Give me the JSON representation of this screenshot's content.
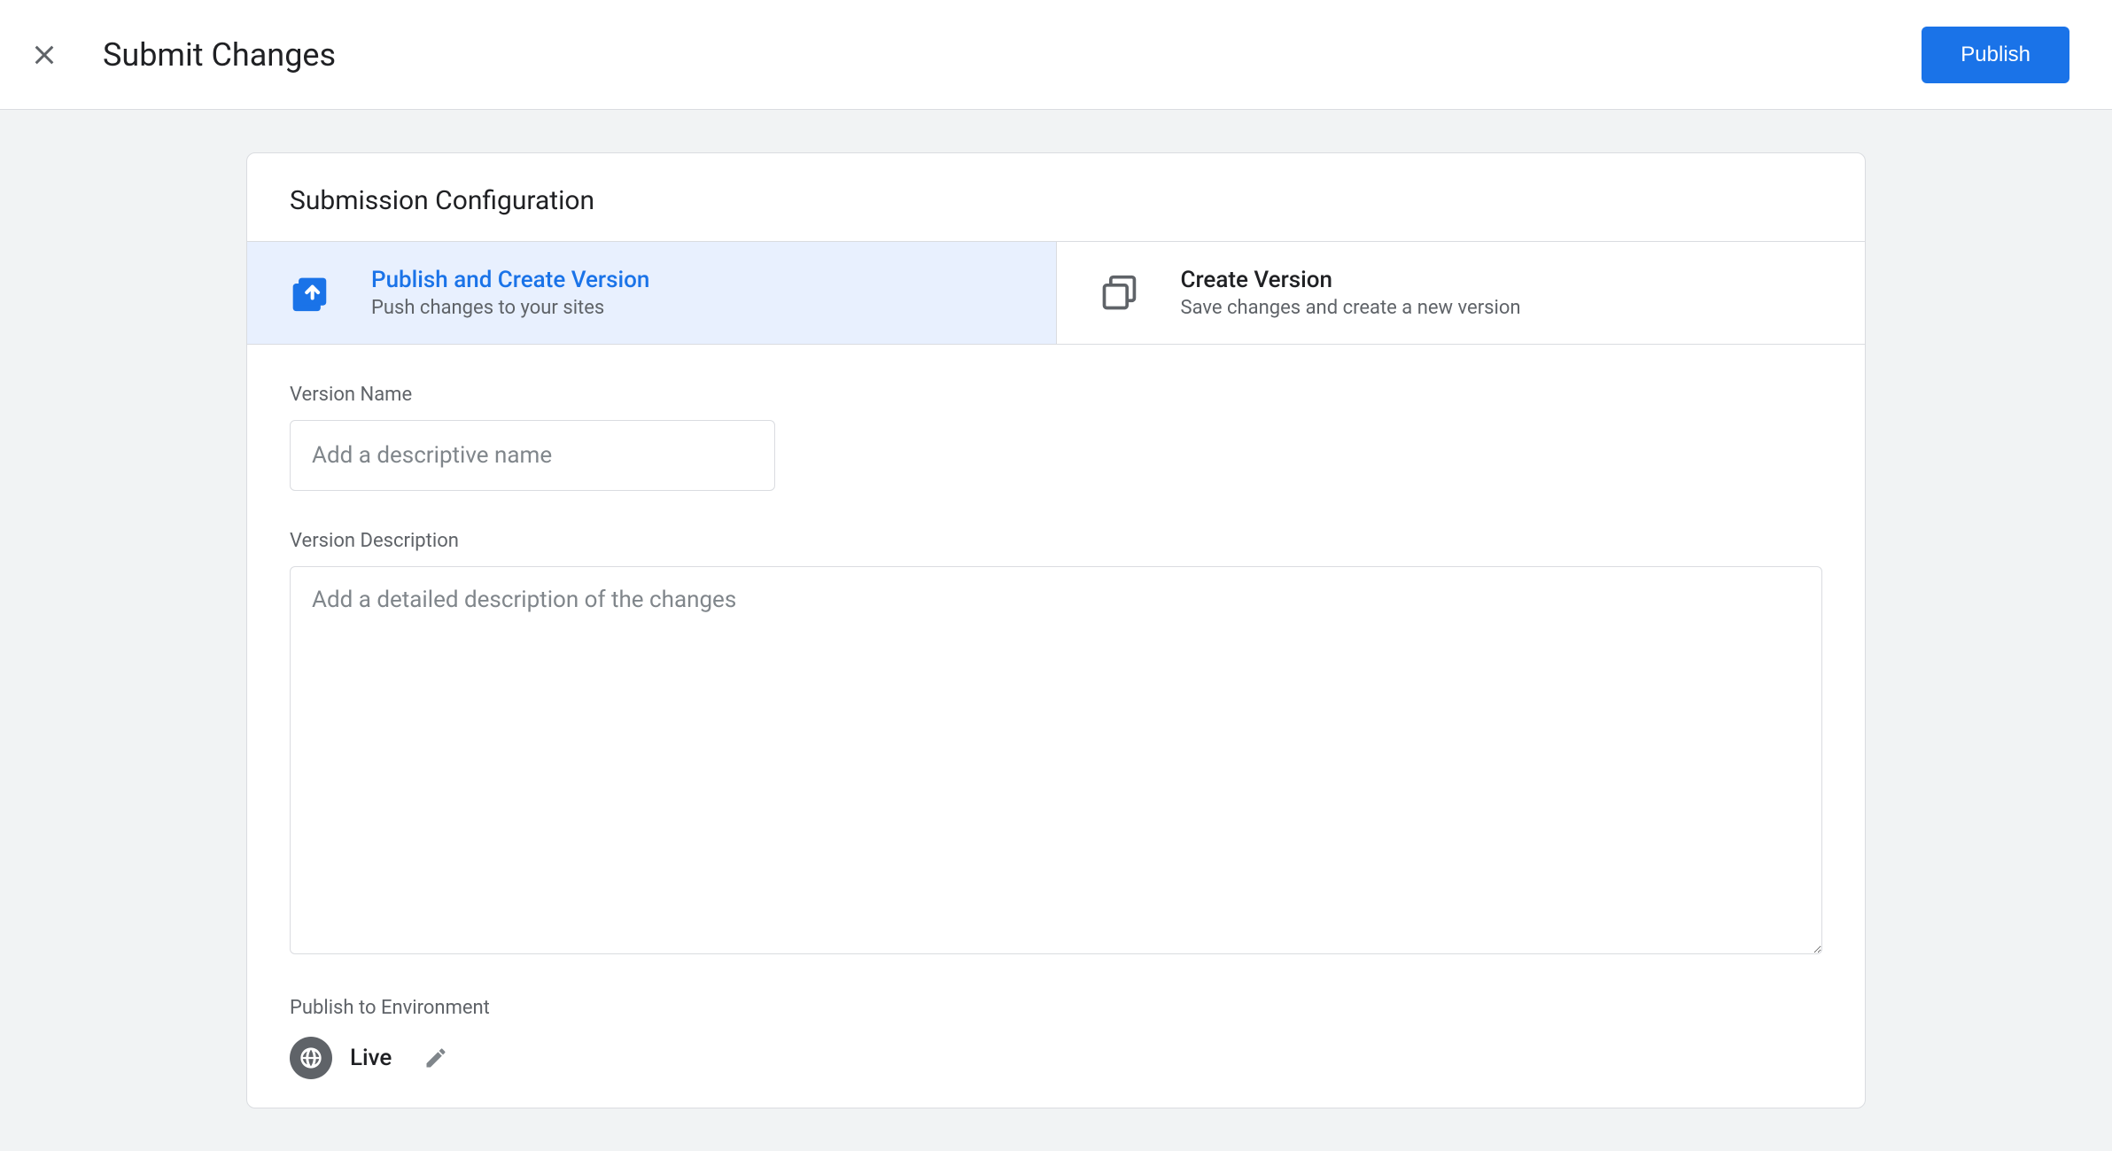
{
  "header": {
    "title": "Submit Changes",
    "publish_label": "Publish"
  },
  "card": {
    "title": "Submission Configuration",
    "tabs": [
      {
        "title": "Publish and Create Version",
        "subtitle": "Push changes to your sites",
        "selected": true
      },
      {
        "title": "Create Version",
        "subtitle": "Save changes and create a new version",
        "selected": false
      }
    ],
    "version_name": {
      "label": "Version Name",
      "placeholder": "Add a descriptive name",
      "value": ""
    },
    "version_description": {
      "label": "Version Description",
      "placeholder": "Add a detailed description of the changes",
      "value": ""
    },
    "environment": {
      "label": "Publish to Environment",
      "name": "Live"
    }
  }
}
